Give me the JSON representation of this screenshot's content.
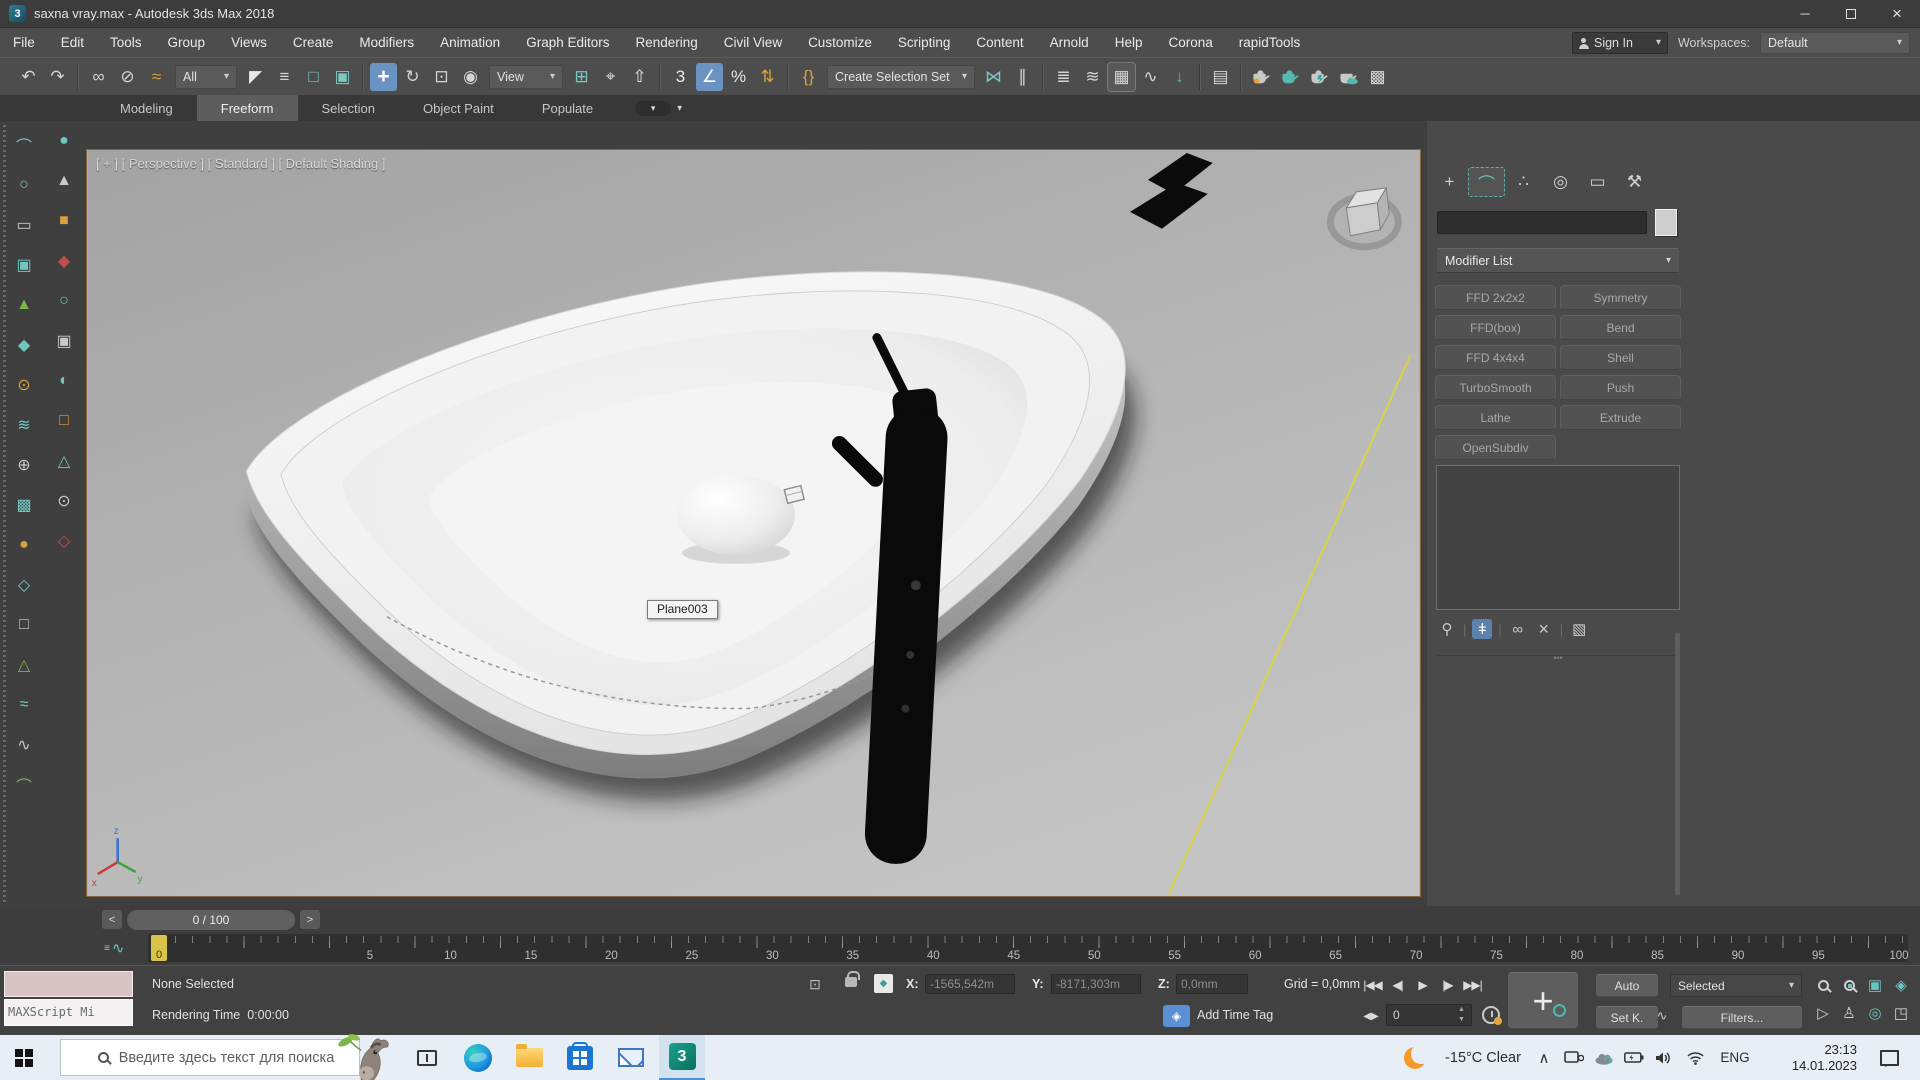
{
  "window": {
    "title": "saxna vray.max - Autodesk 3ds Max 2018",
    "app_icon_glyph": "3",
    "controls": {
      "minimize": "─",
      "close": "×"
    }
  },
  "icons": {
    "caret": "▾",
    "spin_up": "▲",
    "spin_down": "▼"
  },
  "menu": {
    "items": [
      {
        "name": "menu-file",
        "label": "File"
      },
      {
        "name": "menu-edit",
        "label": "Edit"
      },
      {
        "name": "menu-tools",
        "label": "Tools"
      },
      {
        "name": "menu-group",
        "label": "Group"
      },
      {
        "name": "menu-views",
        "label": "Views"
      },
      {
        "name": "menu-create",
        "label": "Create"
      },
      {
        "name": "menu-modifiers",
        "label": "Modifiers"
      },
      {
        "name": "menu-animation",
        "label": "Animation"
      },
      {
        "name": "menu-graph-editors",
        "label": "Graph Editors"
      },
      {
        "name": "menu-rendering",
        "label": "Rendering"
      },
      {
        "name": "menu-civil-view",
        "label": "Civil View"
      },
      {
        "name": "menu-customize",
        "label": "Customize"
      },
      {
        "name": "menu-scripting",
        "label": "Scripting"
      },
      {
        "name": "menu-content",
        "label": "Content"
      },
      {
        "name": "menu-arnold",
        "label": "Arnold"
      },
      {
        "name": "menu-help",
        "label": "Help"
      },
      {
        "name": "menu-corona",
        "label": "Corona"
      },
      {
        "name": "menu-rapidtools",
        "label": "rapidTools"
      }
    ]
  },
  "account": {
    "sign_in": "Sign In",
    "workspaces_label": "Workspaces:",
    "workspace_value": "Default"
  },
  "toolbar": {
    "filter_value": "All",
    "view_value": "View",
    "selection_set_value": "Create Selection Set",
    "move_glyph": "+",
    "angle_snap_glyph": "∠",
    "curve_editor_glyph": "▦",
    "g1": [
      {
        "name": "undo-icon",
        "glyph": "↶",
        "color": "#d4d4d4"
      },
      {
        "name": "redo-icon",
        "glyph": "↷",
        "color": "#d4d4d4"
      }
    ],
    "g2": [
      {
        "name": "select-and-link-icon",
        "glyph": "∞",
        "color": "#d4d4d4"
      },
      {
        "name": "unlink-selection-icon",
        "glyph": "⊘",
        "color": "#d4d4d4"
      },
      {
        "name": "bind-to-space-warp-icon",
        "glyph": "≈",
        "color": "#d9a23a"
      }
    ],
    "g3": [
      {
        "name": "select-object-icon",
        "glyph": "◤",
        "color": "#e8e8e8"
      },
      {
        "name": "select-by-name-icon",
        "glyph": "≡",
        "color": "#d4d4d4"
      },
      {
        "name": "rectangular-selection-region-icon",
        "glyph": "□",
        "color": "#7cc7c2"
      },
      {
        "name": "window-crossing-icon",
        "glyph": "▣",
        "color": "#7cc7c2"
      }
    ],
    "g4": [
      {
        "name": "rotate-icon",
        "glyph": "↻",
        "color": "#d4d4d4"
      },
      {
        "name": "scale-icon",
        "glyph": "⊡",
        "color": "#d4d4d4"
      },
      {
        "name": "select-and-place-icon",
        "glyph": "◉",
        "color": "#d4d4d4"
      }
    ],
    "g5": [
      {
        "name": "use-pivot-center-icon",
        "glyph": "⊞",
        "color": "#7cc7c2"
      },
      {
        "name": "select-and-manipulate-icon",
        "glyph": "⌖",
        "color": "#d4d4d4"
      },
      {
        "name": "keyboard-override-icon",
        "glyph": "⇧",
        "color": "#e8e8e8"
      }
    ],
    "g6a": [
      {
        "name": "snaps-toggle-icon",
        "glyph": "3",
        "color": "#e8e8e8"
      }
    ],
    "g6b": [
      {
        "name": "percent-snap-icon",
        "glyph": "%",
        "color": "#e8e8e8"
      },
      {
        "name": "spinner-snap-icon",
        "glyph": "⇅",
        "color": "#d9a23a"
      }
    ],
    "g7": [
      {
        "name": "named-selection-sets-icon",
        "glyph": "{}",
        "color": "#d9a23a"
      }
    ],
    "g8": [
      {
        "name": "mirror-icon",
        "glyph": "⋈",
        "color": "#7cc7c2"
      },
      {
        "name": "align-icon",
        "glyph": "∥",
        "color": "#d4d4d4"
      }
    ],
    "g9": [
      {
        "name": "scene-explorer-icon",
        "glyph": "≣",
        "color": "#d4d4d4"
      },
      {
        "name": "layer-explorer-icon",
        "glyph": "≋",
        "color": "#d4d4d4"
      }
    ],
    "g10": [
      {
        "name": "schematic-view-icon",
        "glyph": "∿",
        "color": "#d4d4d4"
      },
      {
        "name": "material-editor-icon",
        "glyph": "↓",
        "color": "#56b8ae"
      }
    ],
    "g11": [
      {
        "name": "render-setup-icon",
        "glyph": "▤",
        "color": "#d4d4d4"
      }
    ],
    "g12": [
      {
        "name": "asset-library-icon",
        "glyph": "▩",
        "color": "#d4d4d4"
      }
    ]
  },
  "ribbon": {
    "tabs": [
      {
        "label": "Modeling"
      },
      {
        "label": "Freeform"
      },
      {
        "label": "Selection"
      },
      {
        "label": "Object Paint"
      },
      {
        "label": "Populate"
      }
    ]
  },
  "left_toolbar": {
    "col1": [
      {
        "name": "left-toolbar-icon",
        "glyph": "⌒",
        "color": "#6fc7c0"
      },
      {
        "name": "left-toolbar-icon",
        "glyph": "○",
        "color": "#6fc7c0"
      },
      {
        "name": "left-toolbar-icon",
        "glyph": "▭",
        "color": "#c9c9c9"
      },
      {
        "name": "left-toolbar-icon",
        "glyph": "▣",
        "color": "#6fc7c0"
      },
      {
        "name": "left-toolbar-icon",
        "glyph": "▲",
        "color": "#7ab648"
      },
      {
        "name": "left-toolbar-icon",
        "glyph": "◆",
        "color": "#6fc7c0"
      },
      {
        "name": "left-toolbar-icon",
        "glyph": "⊙",
        "color": "#d9a23a"
      },
      {
        "name": "left-toolbar-icon",
        "glyph": "≋",
        "color": "#6fc7c0"
      },
      {
        "name": "left-toolbar-icon",
        "glyph": "⊕",
        "color": "#c9c9c9"
      },
      {
        "name": "left-toolbar-icon",
        "glyph": "▩",
        "color": "#6fc7c0"
      },
      {
        "name": "left-toolbar-icon",
        "glyph": "●",
        "color": "#d9a23a"
      },
      {
        "name": "left-toolbar-icon",
        "glyph": "◇",
        "color": "#6fc7c0"
      },
      {
        "name": "left-toolbar-icon",
        "glyph": "□",
        "color": "#c9c9c9"
      },
      {
        "name": "left-toolbar-icon",
        "glyph": "△",
        "color": "#7ab648"
      },
      {
        "name": "left-toolbar-icon",
        "glyph": "≈",
        "color": "#6fc7c0"
      },
      {
        "name": "left-toolbar-icon",
        "glyph": "∿",
        "color": "#c9c9c9"
      },
      {
        "name": "left-toolbar-icon",
        "glyph": "⌒",
        "color": "#7ab648"
      }
    ],
    "col2": [
      {
        "name": "left-toolbar-icon",
        "glyph": "●",
        "color": "#6fc7c0"
      },
      {
        "name": "left-toolbar-icon",
        "glyph": "▲",
        "color": "#c9c9c9"
      },
      {
        "name": "left-toolbar-icon",
        "glyph": "■",
        "color": "#d9a23a"
      },
      {
        "name": "left-toolbar-icon",
        "glyph": "◆",
        "color": "#c0504a"
      },
      {
        "name": "left-toolbar-icon",
        "glyph": "○",
        "color": "#6fc7c0"
      },
      {
        "name": "left-toolbar-icon",
        "glyph": "▣",
        "color": "#c9c9c9"
      },
      {
        "name": "left-toolbar-icon",
        "glyph": "◐",
        "color": "#6fc7c0"
      },
      {
        "name": "left-toolbar-icon",
        "glyph": "□",
        "color": "#d9a23a"
      },
      {
        "name": "left-toolbar-icon",
        "glyph": "△",
        "color": "#6fc7c0"
      },
      {
        "name": "left-toolbar-icon",
        "glyph": "⊙",
        "color": "#c9c9c9"
      },
      {
        "name": "left-toolbar-icon",
        "glyph": "◇",
        "color": "#c0504a"
      }
    ]
  },
  "viewport": {
    "label": "[ + ] [ Perspective ] [ Standard ] [ Default Shading ]",
    "tooltip": "Plane003"
  },
  "command_panel": {
    "tabs": [
      {
        "name": "tab-create",
        "glyph": "+"
      },
      {
        "name": "tab-modify",
        "glyph": "⌒"
      },
      {
        "name": "tab-hierarchy",
        "glyph": "∴"
      },
      {
        "name": "tab-motion",
        "glyph": "◎"
      },
      {
        "name": "tab-display",
        "glyph": "▭"
      },
      {
        "name": "tab-utilities",
        "glyph": "⚒"
      }
    ],
    "object_name_value": "",
    "modifier_list_label": "Modifier List",
    "modifier_buttons": [
      {
        "name": "modifier-ffd-2x2x2",
        "label": "FFD 2x2x2"
      },
      {
        "name": "modifier-symmetry",
        "label": "Symmetry"
      },
      {
        "name": "modifier-ffd-box",
        "label": "FFD(box)"
      },
      {
        "name": "modifier-bend",
        "label": "Bend"
      },
      {
        "name": "modifier-ffd-4x4x4",
        "label": "FFD 4x4x4"
      },
      {
        "name": "modifier-shell",
        "label": "Shell"
      },
      {
        "name": "modifier-turbosmooth",
        "label": "TurboSmooth"
      },
      {
        "name": "modifier-push",
        "label": "Push"
      },
      {
        "name": "modifier-lathe",
        "label": "Lathe"
      },
      {
        "name": "modifier-extrude",
        "label": "Extrude"
      },
      {
        "name": "modifier-opensubdiv",
        "label": "OpenSubdiv"
      }
    ],
    "stack_icons": {
      "pin": "⚲",
      "show_end_result": "ǂ",
      "make_unique": "∞",
      "remove": "×",
      "configure": "▧"
    },
    "grip_dots": "•••"
  },
  "trackbar": {
    "prev": "<",
    "value": "0 / 100",
    "next": ">"
  },
  "timeline": {
    "slider_value": "0",
    "curve_icon": "∿",
    "labels": [
      "5",
      "10",
      "15",
      "20",
      "25",
      "30",
      "35",
      "40",
      "45",
      "50",
      "55",
      "60",
      "65",
      "70",
      "75",
      "80",
      "85",
      "90",
      "95",
      "100"
    ]
  },
  "status": {
    "selection": "None Selected",
    "maxscript": "MAXScript Mi",
    "rendering_time_label": "Rendering Time",
    "rendering_time_value": "0:00:00",
    "isolate_glyph": "⊡",
    "abs_glyph": "◆",
    "x_label": "X:",
    "x_value": "-1565,542m",
    "y_label": "Y:",
    "y_value": "-8171,303m",
    "z_label": "Z:",
    "z_value": "0,0mm",
    "grid": "Grid = 0,0mm",
    "add_time_tag_glyph": "◈",
    "add_time_tag": "Add Time Tag",
    "playback": [
      {
        "name": "go-to-start-button",
        "glyph": "|◀◀"
      },
      {
        "name": "previous-frame-button",
        "glyph": "◀|"
      },
      {
        "name": "play-button",
        "glyph": "▶"
      },
      {
        "name": "next-frame-button",
        "glyph": "|▶"
      },
      {
        "name": "go-to-end-button",
        "glyph": "▶▶|"
      }
    ],
    "key_mode_glyph": "◀▶",
    "frame_value": "0",
    "big_key_glyph": "+",
    "auto": "Auto",
    "selected": "Selected",
    "set_key": "Set K.",
    "key_filter_glyph": "∿",
    "filters": "Filters...",
    "nav": {
      "zoom_extents": "▣",
      "zoom_region": "◈",
      "fov": "▷",
      "walk": "♙",
      "orbit": "◎",
      "maximize": "◳"
    }
  },
  "taskbar": {
    "search_placeholder": "Введите здесь текст для поиска",
    "max_icon_glyph": "3",
    "weather": "-15°C Clear",
    "caret_up": "∧",
    "lang": "ENG",
    "time": "23:13",
    "date": "14.01.2023"
  },
  "colors": {
    "accent_blue": "#6a93c2",
    "teal": "#6fc7c0",
    "yellow_spline": "#d6d24e",
    "slider_yellow": "#d9c44a",
    "taskbar_bg": "#e8eef5"
  }
}
